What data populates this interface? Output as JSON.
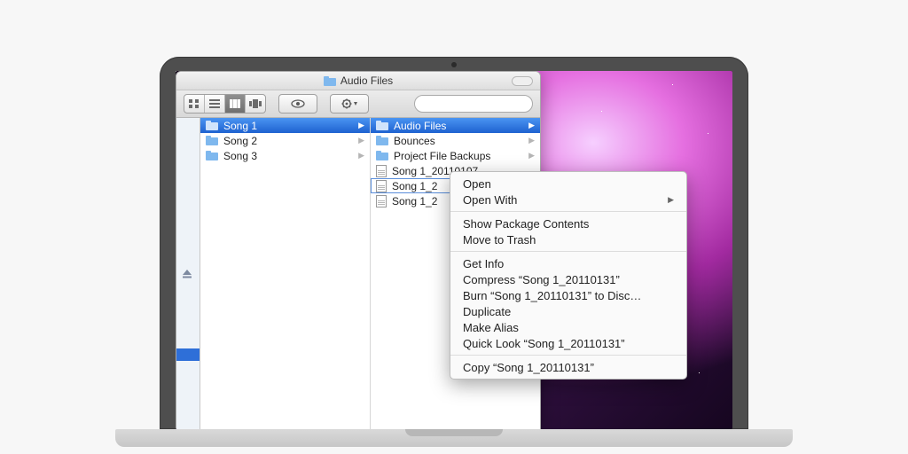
{
  "window": {
    "title": "Audio Files"
  },
  "toolbar": {
    "search_placeholder": ""
  },
  "columns": [
    {
      "items": [
        {
          "icon": "folder",
          "label": "Song 1",
          "has_children": true,
          "selected": true
        },
        {
          "icon": "folder",
          "label": "Song 2",
          "has_children": true
        },
        {
          "icon": "folder",
          "label": "Song 3",
          "has_children": true
        }
      ]
    },
    {
      "items": [
        {
          "icon": "folder",
          "label": "Audio Files",
          "has_children": true,
          "selected": true
        },
        {
          "icon": "folder",
          "label": "Bounces",
          "has_children": true
        },
        {
          "icon": "folder",
          "label": "Project File Backups",
          "has_children": true
        },
        {
          "icon": "doc",
          "label": "Song 1_20110107"
        },
        {
          "icon": "doc",
          "label": "Song 1_2",
          "boxed": true
        },
        {
          "icon": "doc",
          "label": "Song 1_2"
        }
      ]
    }
  ],
  "context_menu": {
    "groups": [
      [
        {
          "label": "Open"
        },
        {
          "label": "Open With",
          "submenu": true
        }
      ],
      [
        {
          "label": "Show Package Contents"
        },
        {
          "label": "Move to Trash"
        }
      ],
      [
        {
          "label": "Get Info"
        },
        {
          "label": "Compress “Song 1_20110131”"
        },
        {
          "label": "Burn “Song 1_20110131” to Disc…"
        },
        {
          "label": "Duplicate"
        },
        {
          "label": "Make Alias"
        },
        {
          "label": "Quick Look “Song 1_20110131”"
        }
      ],
      [
        {
          "label": "Copy “Song 1_20110131”"
        }
      ]
    ]
  }
}
